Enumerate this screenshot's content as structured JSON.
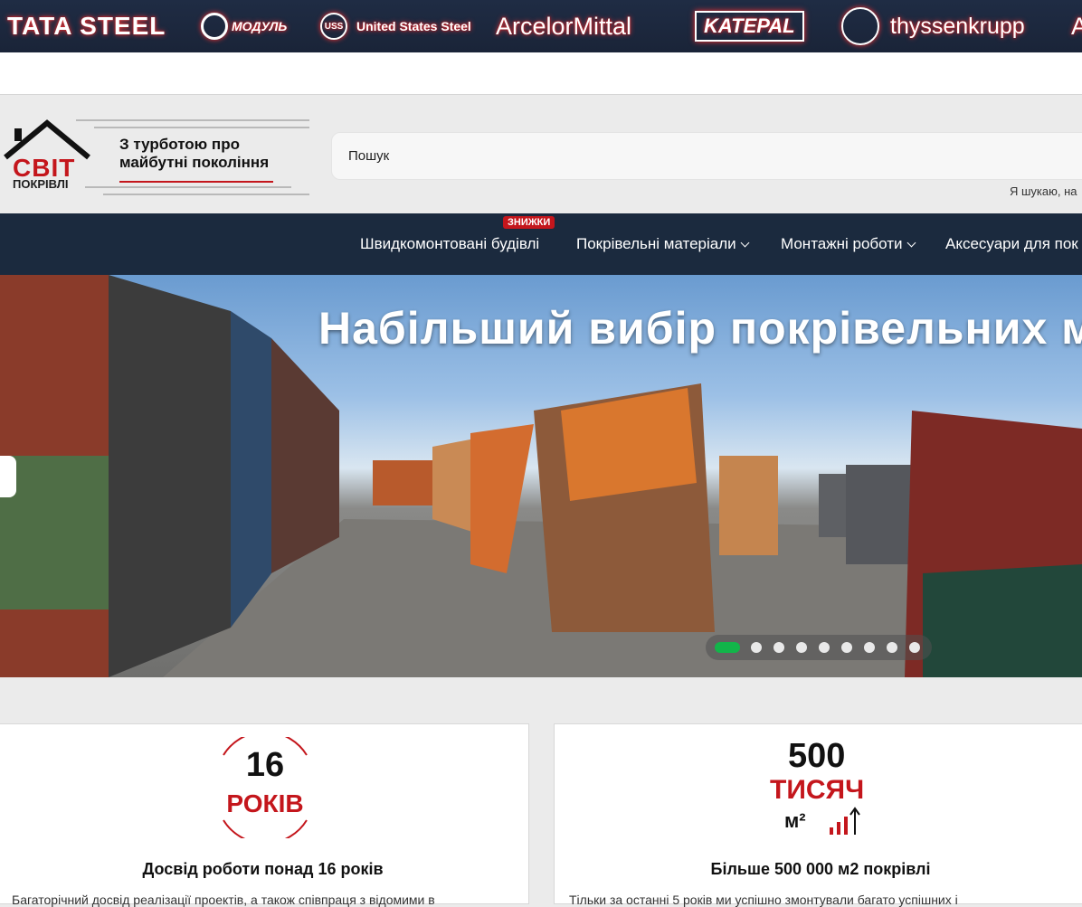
{
  "brands": [
    "TATA STEEL",
    "МОДУЛЬ",
    "United States Steel",
    "ArcelorMittal",
    "KATEPAL",
    "thyssenkrupp",
    "A"
  ],
  "brand_uss_mark": "USS",
  "logo": {
    "brand": "СВІТ",
    "brand_sub": "ПОКРІВЛІ",
    "slogan": "З турботою про майбутні покоління"
  },
  "search": {
    "placeholder": "Пошук",
    "hint": "Я шукаю, на"
  },
  "nav": {
    "badge": "ЗНИЖКИ",
    "items": [
      "Швидкомонтовані будівлі",
      "Покрівельні матеріали",
      "Монтажні роботи",
      "Аксесуари для пок"
    ]
  },
  "hero": {
    "title": "Набільший вибір покрівельних м",
    "slides": 9,
    "active_slide": 1
  },
  "cards": [
    {
      "badge_number": "16",
      "badge_label": "РОКІВ",
      "title": "Досвід роботи понад 16 років",
      "text": "Багаторічний досвід реалізації проектів, а також співпраця з відомими в"
    },
    {
      "badge_number": "500",
      "badge_label": "ТИСЯЧ",
      "badge_unit": "м²",
      "title": "Більше 500 000 м2 покрівлі",
      "text": "Тільки за останні 5 років ми успішно змонтували багато успішних і"
    }
  ],
  "colors": {
    "accent_red": "#c4161c",
    "nav_bg": "#1b2a3e",
    "active_dot": "#12b54a"
  }
}
